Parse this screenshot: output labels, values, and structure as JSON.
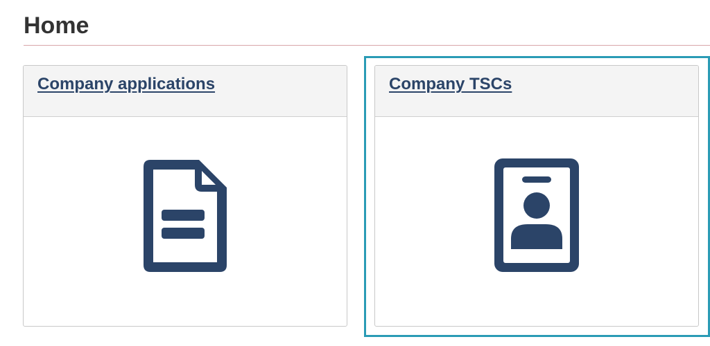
{
  "page": {
    "title": "Home"
  },
  "cards": [
    {
      "label": "Company applications",
      "icon": "document-icon"
    },
    {
      "label": "Company TSCs",
      "icon": "id-badge-icon"
    }
  ],
  "colors": {
    "title_text": "#333333",
    "link": "#2b4468",
    "icon": "#2b4468",
    "card_header_bg": "#f4f4f4",
    "card_border": "#c8c8c8",
    "focus_ring": "#2a9bb5",
    "title_rule": "#d9a5a8"
  }
}
